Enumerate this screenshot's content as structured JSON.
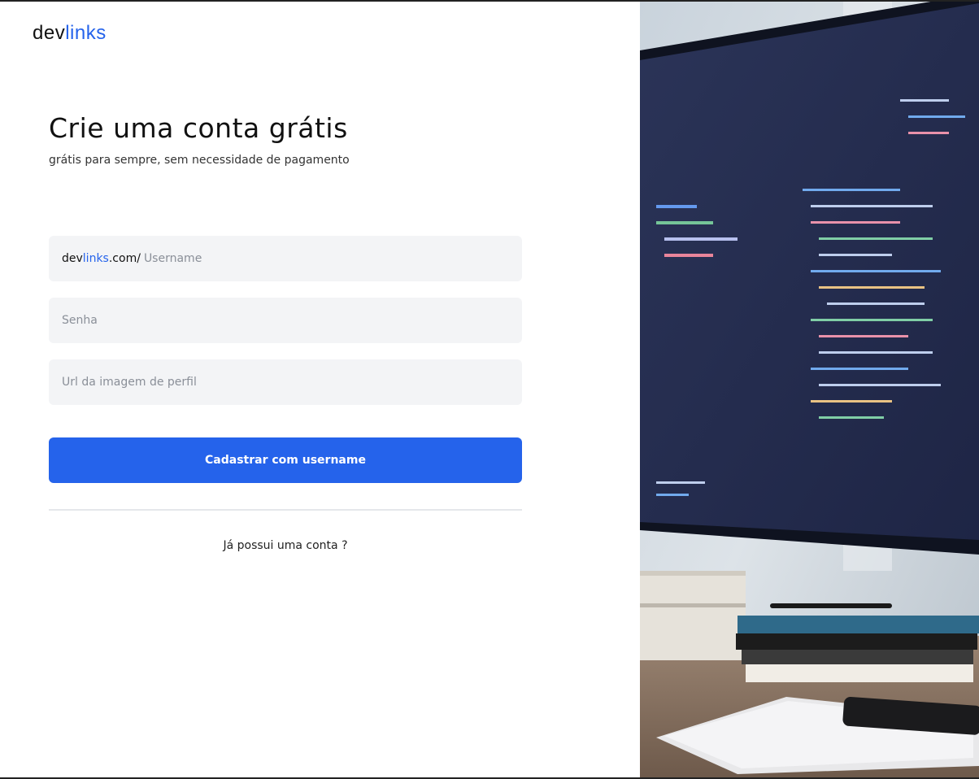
{
  "logo": {
    "part1": "dev",
    "part2": "links"
  },
  "page": {
    "title": "Crie uma conta grátis",
    "subtitle": "grátis para sempre, sem necessidade de pagamento"
  },
  "form": {
    "username_prefix": {
      "part1": "dev",
      "part2": "links",
      "part3": ".com/"
    },
    "username_placeholder": "Username",
    "password_placeholder": "Senha",
    "profile_url_placeholder": "Url da imagem de perfil",
    "submit_label": "Cadastrar com username"
  },
  "login_link": "Já possui uma conta ?",
  "colors": {
    "accent": "#2563eb",
    "field_bg": "#f3f4f6"
  }
}
